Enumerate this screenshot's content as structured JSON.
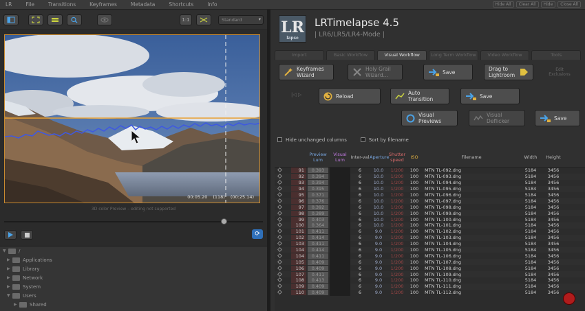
{
  "menu": [
    "LR",
    "File",
    "Transitions",
    "Keyframes",
    "Metadata",
    "Shortcuts",
    "Info"
  ],
  "window_buttons": [
    "Hide All",
    "Clear All",
    "Hide",
    "Close All"
  ],
  "left_toolbar": {
    "zoom_label": "1:1",
    "select_value": "Standard"
  },
  "preview": {
    "time_code": "00:05.20",
    "frame": "(118)",
    "duration": "(00:25.14)",
    "caption": "3D color Preview – editing not supported"
  },
  "playback": {
    "slider_position": 0.86
  },
  "tree": [
    {
      "label": "/",
      "indent": 0
    },
    {
      "label": "Applications",
      "indent": 1
    },
    {
      "label": "Library",
      "indent": 1
    },
    {
      "label": "Network",
      "indent": 1
    },
    {
      "label": "System",
      "indent": 1
    },
    {
      "label": "Users",
      "indent": 1
    },
    {
      "label": "Shared",
      "indent": 2
    }
  ],
  "app": {
    "logo_text": "LR",
    "logo_sub": "lapse",
    "title": "LRTimelapse 4.5",
    "subtitle": "| LR6/LR5/LR4-Mode |"
  },
  "tabs": [
    {
      "label": "Import",
      "active": false
    },
    {
      "label": "Basic Workflow",
      "active": false
    },
    {
      "label": "Visual Workflow",
      "active": true
    },
    {
      "label": "Long Term Workflow",
      "active": false
    },
    {
      "label": "Video Workflow",
      "active": false
    },
    {
      "label": "Tools",
      "active": false
    }
  ],
  "buttons": {
    "keyframes_wizard": "Keyframes Wizard",
    "holy_grail_wizard": "Holy Grail Wizard...",
    "save1": "Save",
    "drag_to_lightroom": "Drag to Lightroom",
    "edit_exclusions": "Edit Exclusions",
    "reload": "Reload",
    "auto_transition": "Auto Transition",
    "save2": "Save",
    "visual_previews": "Visual Previews",
    "visual_deflicker": "Visual Deflicker",
    "save3": "Save"
  },
  "checks": {
    "hide_unchanged": "Hide unchanged columns",
    "sort_by_filename": "Sort by filename"
  },
  "table": {
    "headers": {
      "preview_lum": "Preview Lum",
      "visual_lum": "Visual Lum",
      "interval": "Inter-val",
      "aperture": "Aperture",
      "shutter": "Shutter speed",
      "iso": "ISO",
      "filename": "Filename",
      "width": "Width",
      "height": "Height"
    },
    "colors": {
      "preview_lum": "#78a6e0",
      "visual_lum": "#c179e0",
      "aperture": "#78a6e0",
      "shutter": "#d96a6a",
      "iso": "#e0b040"
    },
    "rows": [
      {
        "nr": "91",
        "lum": "0.393",
        "iv": "6",
        "ap": "10.0",
        "ss": "1/200",
        "iso": "100",
        "fn": "MTN TL-092.dng",
        "w": "5184",
        "h": "3456"
      },
      {
        "nr": "92",
        "lum": "0.394",
        "iv": "6",
        "ap": "10.0",
        "ss": "1/200",
        "iso": "100",
        "fn": "MTN TL-093.dng",
        "w": "5184",
        "h": "3456"
      },
      {
        "nr": "93",
        "lum": "0.394",
        "iv": "6",
        "ap": "10.0",
        "ss": "1/200",
        "iso": "100",
        "fn": "MTN TL-094.dng",
        "w": "5184",
        "h": "3456"
      },
      {
        "nr": "94",
        "lum": "0.395",
        "iv": "6",
        "ap": "10.0",
        "ss": "1/200",
        "iso": "100",
        "fn": "MTN TL-095.dng",
        "w": "5184",
        "h": "3456"
      },
      {
        "nr": "95",
        "lum": "0.371",
        "iv": "6",
        "ap": "10.0",
        "ss": "1/200",
        "iso": "100",
        "fn": "MTN TL-096.dng",
        "w": "5184",
        "h": "3456"
      },
      {
        "nr": "96",
        "lum": "0.376",
        "iv": "6",
        "ap": "10.0",
        "ss": "1/200",
        "iso": "100",
        "fn": "MTN TL-097.dng",
        "w": "5184",
        "h": "3456"
      },
      {
        "nr": "97",
        "lum": "0.392",
        "iv": "6",
        "ap": "10.0",
        "ss": "1/200",
        "iso": "100",
        "fn": "MTN TL-098.dng",
        "w": "5184",
        "h": "3456"
      },
      {
        "nr": "98",
        "lum": "0.389",
        "iv": "6",
        "ap": "10.0",
        "ss": "1/200",
        "iso": "100",
        "fn": "MTN TL-099.dng",
        "w": "5184",
        "h": "3456"
      },
      {
        "nr": "99",
        "lum": "0.403",
        "iv": "6",
        "ap": "10.0",
        "ss": "1/200",
        "iso": "100",
        "fn": "MTN TL-100.dng",
        "w": "5184",
        "h": "3456"
      },
      {
        "nr": "100",
        "lum": "0.364",
        "iv": "6",
        "ap": "10.0",
        "ss": "1/200",
        "iso": "100",
        "fn": "MTN TL-101.dng",
        "w": "5184",
        "h": "3456"
      },
      {
        "nr": "101",
        "lum": "0.411",
        "iv": "6",
        "ap": "9.0",
        "ss": "1/200",
        "iso": "100",
        "fn": "MTN TL-102.dng",
        "w": "5184",
        "h": "3456"
      },
      {
        "nr": "102",
        "lum": "0.414",
        "iv": "6",
        "ap": "9.0",
        "ss": "1/200",
        "iso": "100",
        "fn": "MTN TL-103.dng",
        "w": "5184",
        "h": "3456"
      },
      {
        "nr": "103",
        "lum": "0.411",
        "iv": "6",
        "ap": "9.0",
        "ss": "1/200",
        "iso": "100",
        "fn": "MTN TL-104.dng",
        "w": "5184",
        "h": "3456"
      },
      {
        "nr": "104",
        "lum": "0.414",
        "iv": "6",
        "ap": "9.0",
        "ss": "1/200",
        "iso": "100",
        "fn": "MTN TL-105.dng",
        "w": "5184",
        "h": "3456"
      },
      {
        "nr": "104",
        "lum": "0.411",
        "iv": "6",
        "ap": "9.0",
        "ss": "1/200",
        "iso": "100",
        "fn": "MTN TL-106.dng",
        "w": "5184",
        "h": "3456"
      },
      {
        "nr": "105",
        "lum": "0.409",
        "iv": "6",
        "ap": "9.0",
        "ss": "1/200",
        "iso": "100",
        "fn": "MTN TL-107.dng",
        "w": "5184",
        "h": "3456"
      },
      {
        "nr": "106",
        "lum": "0.409",
        "iv": "6",
        "ap": "9.0",
        "ss": "1/200",
        "iso": "100",
        "fn": "MTN TL-108.dng",
        "w": "5184",
        "h": "3456"
      },
      {
        "nr": "107",
        "lum": "0.411",
        "iv": "6",
        "ap": "9.0",
        "ss": "1/200",
        "iso": "100",
        "fn": "MTN TL-109.dng",
        "w": "5184",
        "h": "3456"
      },
      {
        "nr": "108",
        "lum": "0.413",
        "iv": "6",
        "ap": "9.0",
        "ss": "1/200",
        "iso": "100",
        "fn": "MTN TL-110.dng",
        "w": "5184",
        "h": "3456"
      },
      {
        "nr": "109",
        "lum": "0.409",
        "iv": "6",
        "ap": "9.0",
        "ss": "1/200",
        "iso": "100",
        "fn": "MTN TL-111.dng",
        "w": "5184",
        "h": "3456"
      },
      {
        "nr": "110",
        "lum": "0.409",
        "iv": "6",
        "ap": "9.0",
        "ss": "1/200",
        "iso": "100",
        "fn": "MTN TL-112.dng",
        "w": "5184",
        "h": "3456"
      }
    ]
  }
}
